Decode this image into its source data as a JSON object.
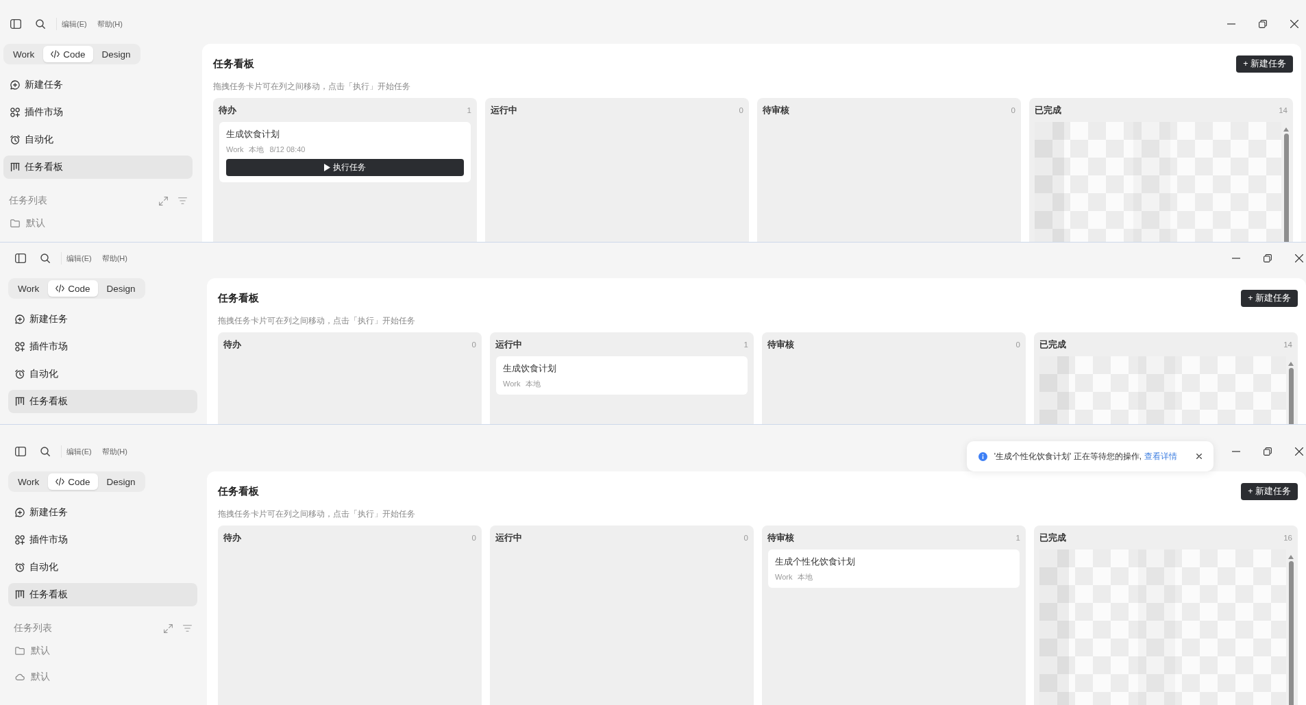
{
  "windows": [
    {
      "menu": [
        "编辑(E)",
        "帮助(H)"
      ],
      "modes": [
        {
          "label": "Work",
          "kind": "text",
          "selected": false
        },
        {
          "label": "Code",
          "kind": "code",
          "selected": true
        },
        {
          "label": "Design",
          "kind": "text",
          "selected": false
        }
      ],
      "nav": [
        {
          "label": "新建任务",
          "kind": "new_task",
          "selected": false
        },
        {
          "label": "插件市场",
          "kind": "plugins",
          "selected": false
        },
        {
          "label": "自动化",
          "kind": "automation",
          "selected": false
        },
        {
          "label": "任务看板",
          "kind": "board",
          "selected": true
        }
      ],
      "task_list": {
        "title": "任务列表",
        "items": [
          {
            "label": "默认",
            "kind": "folder"
          }
        ]
      },
      "board": {
        "title": "任务看板",
        "subtitle": "拖拽任务卡片可在列之间移动，点击「执行」开始任务",
        "new_button": "+ 新建任务",
        "columns": [
          {
            "title": "待办",
            "count": "1",
            "blurred": false,
            "cards": [
              {
                "title": "生成饮食计划",
                "meta": [
                  "Work",
                  "本地",
                  "8/12 08:40"
                ],
                "action": "执行任务"
              }
            ]
          },
          {
            "title": "运行中",
            "count": "0",
            "blurred": false
          },
          {
            "title": "待审核",
            "count": "0",
            "blurred": false
          },
          {
            "title": "已完成",
            "count": "14",
            "blurred": true
          }
        ]
      }
    },
    {
      "menu": [
        "编辑(E)",
        "帮助(H)"
      ],
      "modes": [
        {
          "label": "Work",
          "kind": "text",
          "selected": false
        },
        {
          "label": "Code",
          "kind": "code",
          "selected": true
        },
        {
          "label": "Design",
          "kind": "text",
          "selected": false
        }
      ],
      "nav": [
        {
          "label": "新建任务",
          "kind": "new_task",
          "selected": false
        },
        {
          "label": "插件市场",
          "kind": "plugins",
          "selected": false
        },
        {
          "label": "自动化",
          "kind": "automation",
          "selected": false
        },
        {
          "label": "任务看板",
          "kind": "board",
          "selected": true
        }
      ],
      "board": {
        "title": "任务看板",
        "subtitle": "拖拽任务卡片可在列之间移动，点击「执行」开始任务",
        "new_button": "+ 新建任务",
        "columns": [
          {
            "title": "待办",
            "count": "0",
            "blurred": false
          },
          {
            "title": "运行中",
            "count": "1",
            "blurred": false,
            "cards": [
              {
                "title": "生成饮食计划",
                "meta": [
                  "Work",
                  "本地"
                ]
              }
            ]
          },
          {
            "title": "待审核",
            "count": "0",
            "blurred": false
          },
          {
            "title": "已完成",
            "count": "14",
            "blurred": true
          }
        ]
      }
    },
    {
      "menu": [
        "编辑(E)",
        "帮助(H)"
      ],
      "toast": {
        "message": "'生成个性化饮食计划' 正在等待您的操作,",
        "link": "查看详情"
      },
      "modes": [
        {
          "label": "Work",
          "kind": "text",
          "selected": false
        },
        {
          "label": "Code",
          "kind": "code",
          "selected": true
        },
        {
          "label": "Design",
          "kind": "text",
          "selected": false
        }
      ],
      "nav": [
        {
          "label": "新建任务",
          "kind": "new_task",
          "selected": false
        },
        {
          "label": "插件市场",
          "kind": "plugins",
          "selected": false
        },
        {
          "label": "自动化",
          "kind": "automation",
          "selected": false
        },
        {
          "label": "任务看板",
          "kind": "board",
          "selected": true
        }
      ],
      "task_list": {
        "title": "任务列表",
        "items": [
          {
            "label": "默认",
            "kind": "folder"
          },
          {
            "label": "默认",
            "kind": "cloud"
          }
        ]
      },
      "board": {
        "title": "任务看板",
        "subtitle": "拖拽任务卡片可在列之间移动，点击「执行」开始任务",
        "new_button": "+ 新建任务",
        "columns": [
          {
            "title": "待办",
            "count": "0",
            "blurred": false
          },
          {
            "title": "运行中",
            "count": "0",
            "blurred": false
          },
          {
            "title": "待审核",
            "count": "1",
            "blurred": false,
            "cards": [
              {
                "title": "生成个性化饮食计划",
                "meta": [
                  "Work",
                  "本地"
                ]
              }
            ]
          },
          {
            "title": "已完成",
            "count": "16",
            "blurred": true
          }
        ]
      }
    }
  ]
}
